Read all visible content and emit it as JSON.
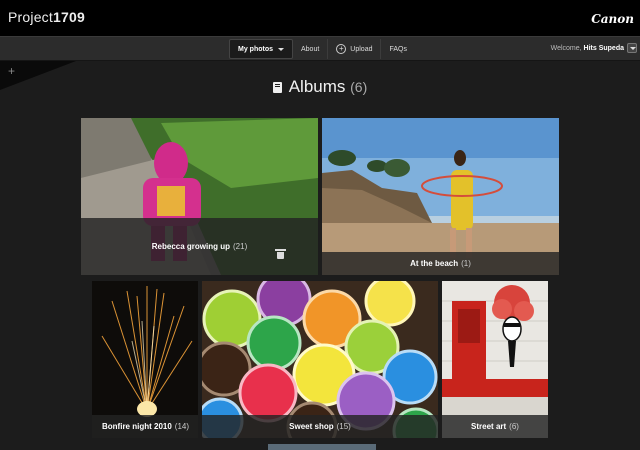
{
  "brand": {
    "name_light": "Project",
    "name_bold": "1709",
    "partner_logo": "Canon"
  },
  "nav": {
    "items": [
      {
        "label": "My photos",
        "active": true,
        "icon": "caret-down"
      },
      {
        "label": "About",
        "active": false
      },
      {
        "label": "Upload",
        "active": false,
        "icon": "plus-circle-icon"
      },
      {
        "label": "FAQs",
        "active": false
      }
    ],
    "welcome_text": "Welcome,",
    "user_name": "Hits Supeda"
  },
  "drawer": {
    "icon": "plus-icon",
    "symbol": "+"
  },
  "heading": {
    "icon": "album-book-icon",
    "title": "Albums",
    "count": "(6)"
  },
  "albums": [
    {
      "name": "Rebecca growing up",
      "count": "(21)",
      "has_delete": true
    },
    {
      "name": "At the beach",
      "count": "(1)"
    },
    {
      "name": "Bonfire night 2010",
      "count": "(14)"
    },
    {
      "name": "Sweet shop",
      "count": "(15)"
    },
    {
      "name": "Street art",
      "count": "(6)"
    }
  ],
  "colors": {
    "background": "#1c1c1c",
    "topbar": "#000000",
    "navbar": "#2c2c2c"
  }
}
